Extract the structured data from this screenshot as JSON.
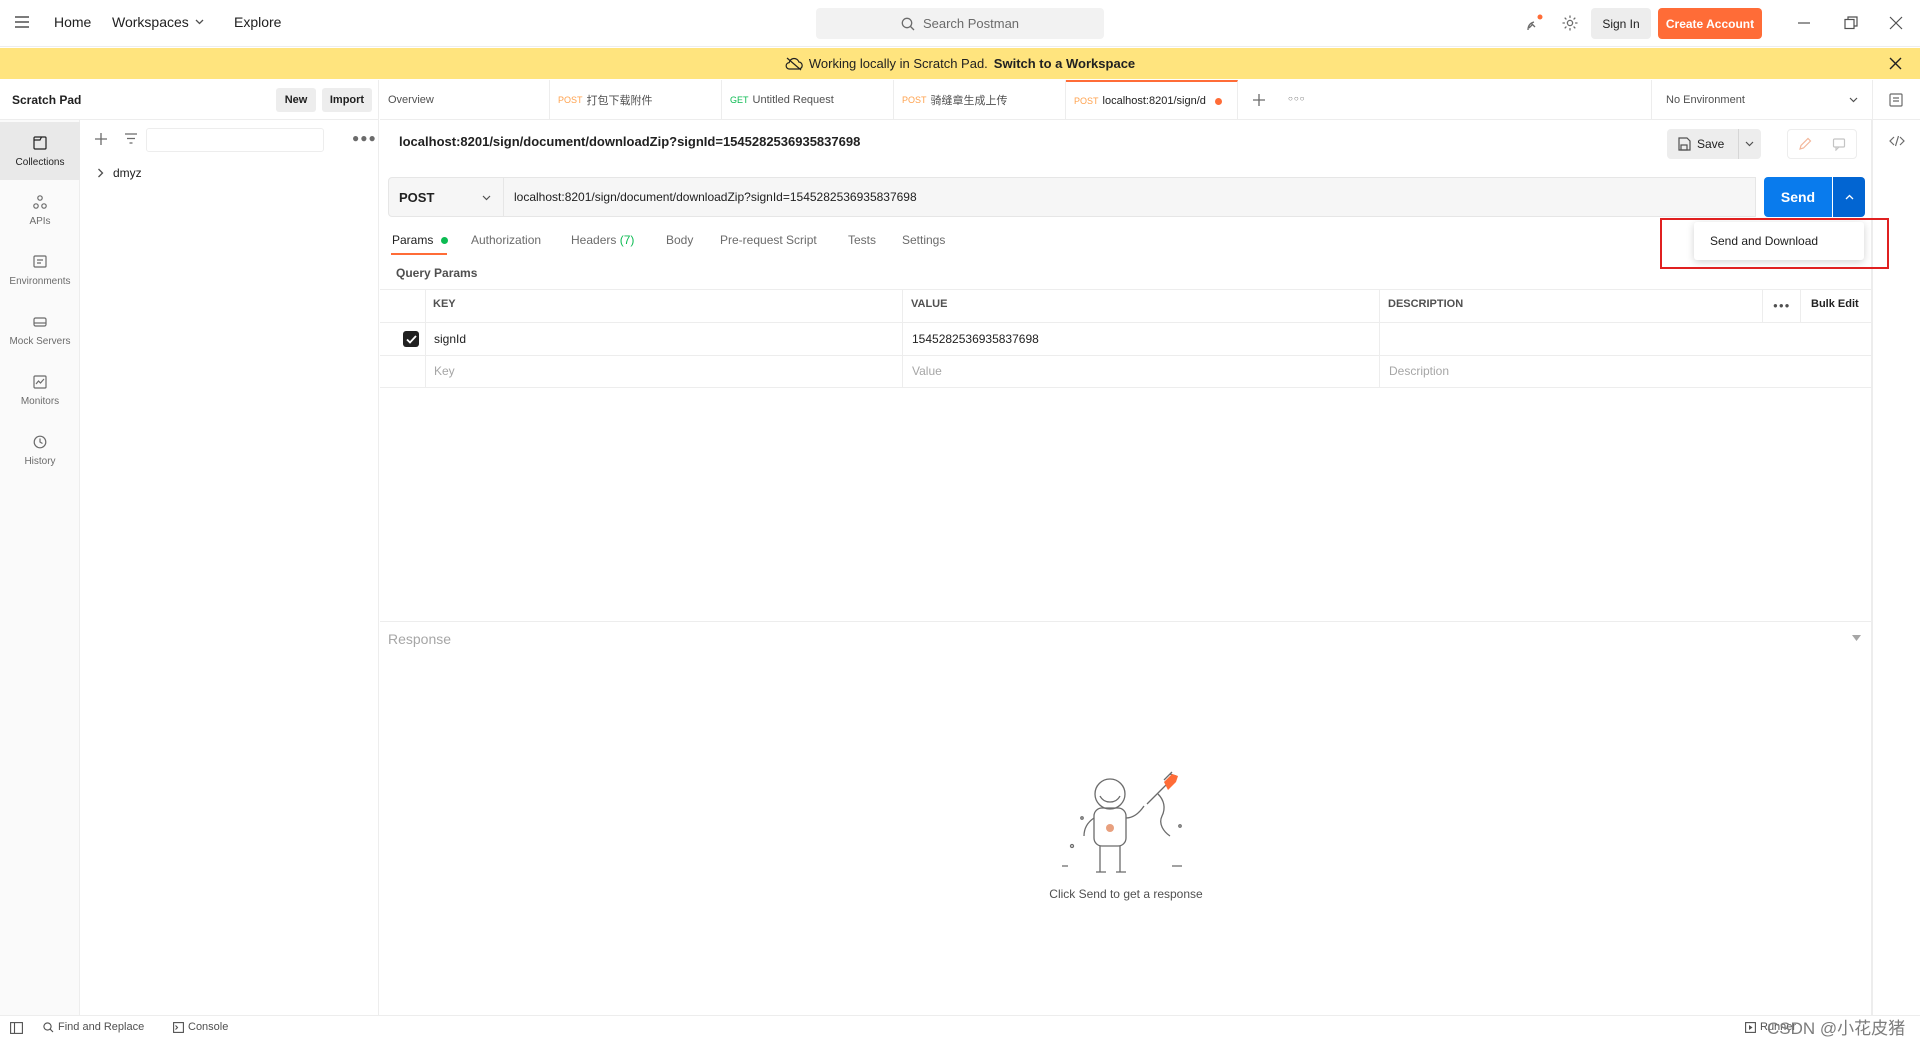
{
  "nav": {
    "home": "Home",
    "workspaces": "Workspaces",
    "explore": "Explore",
    "search_placeholder": "Search Postman",
    "sign_in": "Sign In",
    "create_account": "Create Account"
  },
  "banner": {
    "text": "Working locally in Scratch Pad.",
    "link": "Switch to a Workspace"
  },
  "sidebar": {
    "title": "Scratch Pad",
    "new_label": "New",
    "import_label": "Import",
    "nav_items": [
      {
        "label": "Collections",
        "icon": "collections-icon"
      },
      {
        "label": "APIs",
        "icon": "apis-icon"
      },
      {
        "label": "Environments",
        "icon": "environments-icon"
      },
      {
        "label": "Mock Servers",
        "icon": "mock-servers-icon"
      },
      {
        "label": "Monitors",
        "icon": "monitors-icon"
      },
      {
        "label": "History",
        "icon": "history-icon"
      }
    ],
    "collection_name": "dmyz"
  },
  "tabs": [
    {
      "method": "",
      "label": "Overview"
    },
    {
      "method": "POST",
      "label": "打包下载附件"
    },
    {
      "method": "GET",
      "label": "Untitled Request"
    },
    {
      "method": "POST",
      "label": "骑缝章生成上传"
    },
    {
      "method": "POST",
      "label": "localhost:8201/sign/d"
    }
  ],
  "environment": "No Environment",
  "request": {
    "title": "localhost:8201/sign/document/downloadZip?signId=1545282536935837698",
    "save_label": "Save",
    "method": "POST",
    "url": "localhost:8201/sign/document/downloadZip?signId=1545282536935837698",
    "send_label": "Send",
    "dropdown_item": "Send and Download",
    "tabs": {
      "params": "Params",
      "authorization": "Authorization",
      "headers": "Headers",
      "headers_count": "(7)",
      "body": "Body",
      "prerequest": "Pre-request Script",
      "tests": "Tests",
      "settings": "Settings"
    },
    "query_params_title": "Query Params",
    "table": {
      "key_header": "KEY",
      "value_header": "VALUE",
      "description_header": "DESCRIPTION",
      "bulk_edit": "Bulk Edit",
      "row": {
        "key": "signId",
        "value": "1545282536935837698"
      },
      "placeholder": {
        "key": "Key",
        "value": "Value",
        "description": "Description"
      }
    }
  },
  "response": {
    "title": "Response",
    "empty_text": "Click Send to get a response"
  },
  "statusbar": {
    "find_replace": "Find and Replace",
    "console": "Console",
    "runner": "Runner",
    "watermark": "CSDN @小花皮猪"
  },
  "colors": {
    "accent": "#ff6c37",
    "send_blue": "#097bed",
    "banner_yellow": "#ffe47e",
    "highlight_red": "#e02020"
  }
}
